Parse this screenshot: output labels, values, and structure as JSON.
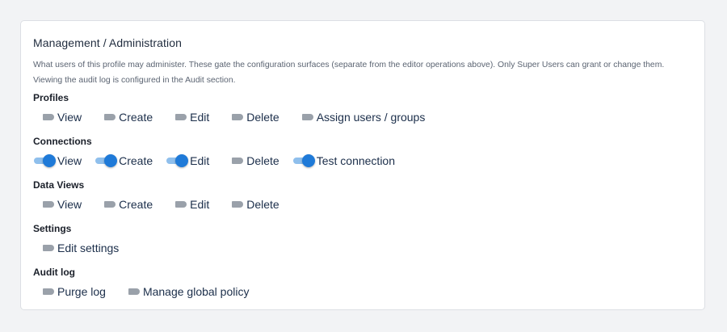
{
  "section": {
    "title": "Management / Administration",
    "description": "What users of this profile may administer. These gate the configuration surfaces (separate from the editor operations above). Only Super Users can grant or change them. Viewing the audit log is configured in the Audit section."
  },
  "accent_color": "#1f7ad8",
  "groups": [
    {
      "label": "Profiles",
      "items": [
        {
          "label": "View",
          "on": false
        },
        {
          "label": "Create",
          "on": false
        },
        {
          "label": "Edit",
          "on": false
        },
        {
          "label": "Delete",
          "on": false
        },
        {
          "label": "Assign users / groups",
          "on": false
        }
      ]
    },
    {
      "label": "Connections",
      "items": [
        {
          "label": "View",
          "on": true
        },
        {
          "label": "Create",
          "on": true
        },
        {
          "label": "Edit",
          "on": true
        },
        {
          "label": "Delete",
          "on": false
        },
        {
          "label": "Test connection",
          "on": true
        }
      ]
    },
    {
      "label": "Data Views",
      "items": [
        {
          "label": "View",
          "on": false
        },
        {
          "label": "Create",
          "on": false
        },
        {
          "label": "Edit",
          "on": false
        },
        {
          "label": "Delete",
          "on": false
        }
      ]
    },
    {
      "label": "Settings",
      "items": [
        {
          "label": "Edit settings",
          "on": false
        }
      ]
    },
    {
      "label": "Audit log",
      "items": [
        {
          "label": "Purge log",
          "on": false
        },
        {
          "label": "Manage global policy",
          "on": false
        }
      ]
    }
  ]
}
